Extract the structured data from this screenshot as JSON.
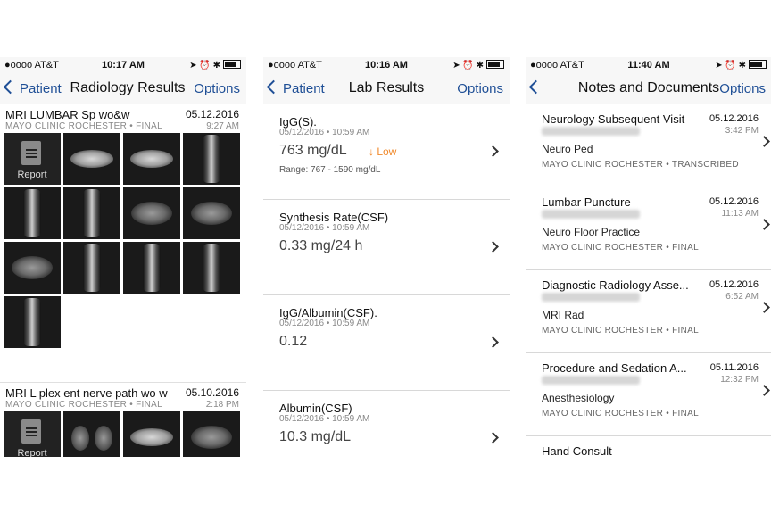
{
  "phone1": {
    "status": {
      "carrier": "●oooo AT&T",
      "time": "10:17 AM"
    },
    "nav": {
      "back_label": "Patient",
      "title": "Radiology Results",
      "options_label": "Options"
    },
    "studies": [
      {
        "title": "MRI LUMBAR Sp wo&w",
        "org": "MAYO CLINIC ROCHESTER • FINAL",
        "date": "05.12.2016",
        "time": "9:27 AM",
        "report_label": "Report"
      },
      {
        "title": "MRI L plex ent nerve path wo w",
        "org": "MAYO CLINIC ROCHESTER • FINAL",
        "date": "05.10.2016",
        "time": "2:18 PM",
        "report_label": "Report"
      }
    ]
  },
  "phone2": {
    "status": {
      "carrier": "●oooo AT&T",
      "time": "10:16 AM"
    },
    "nav": {
      "back_label": "Patient",
      "title": "Lab Results",
      "options_label": "Options"
    },
    "labs": [
      {
        "name": "IgG(S).",
        "date": "05/12/2016 • 10:59 AM",
        "value": "763 mg/dL",
        "flag": "↓  Low",
        "range": "Range: 767  -  1590 mg/dL"
      },
      {
        "name": "Synthesis Rate(CSF)",
        "date": "05/12/2016 • 10:59 AM",
        "value": "0.33 mg/24 h"
      },
      {
        "name": "IgG/Albumin(CSF).",
        "date": "05/12/2016 • 10:59 AM",
        "value": "0.12"
      },
      {
        "name": "Albumin(CSF)",
        "date": "05/12/2016 • 10:59 AM",
        "value": "10.3 mg/dL"
      }
    ]
  },
  "phone3": {
    "status": {
      "carrier": "●oooo AT&T",
      "time": "11:40 AM"
    },
    "nav": {
      "title": "Notes and Documents",
      "options_label": "Options"
    },
    "notes": [
      {
        "title": "Neurology Subsequent Visit",
        "date": "05.12.2016",
        "time": "3:42 PM",
        "dept": "Neuro Ped",
        "org": "MAYO CLINIC ROCHESTER • TRANSCRIBED"
      },
      {
        "title": "Lumbar Puncture",
        "date": "05.12.2016",
        "time": "11:13 AM",
        "dept": "Neuro Floor Practice",
        "org": "MAYO CLINIC ROCHESTER • FINAL"
      },
      {
        "title": "Diagnostic Radiology Asse...",
        "date": "05.12.2016",
        "time": "6:52 AM",
        "dept": "MRI Rad",
        "org": "MAYO CLINIC ROCHESTER • FINAL"
      },
      {
        "title": "Procedure and Sedation A...",
        "date": "05.11.2016",
        "time": "12:32 PM",
        "dept": "Anesthesiology",
        "org": "MAYO CLINIC ROCHESTER • FINAL"
      }
    ],
    "partial_title": "Hand Consult"
  },
  "colors": {
    "accent": "#1f4f96",
    "flag_low": "#f0892b"
  }
}
